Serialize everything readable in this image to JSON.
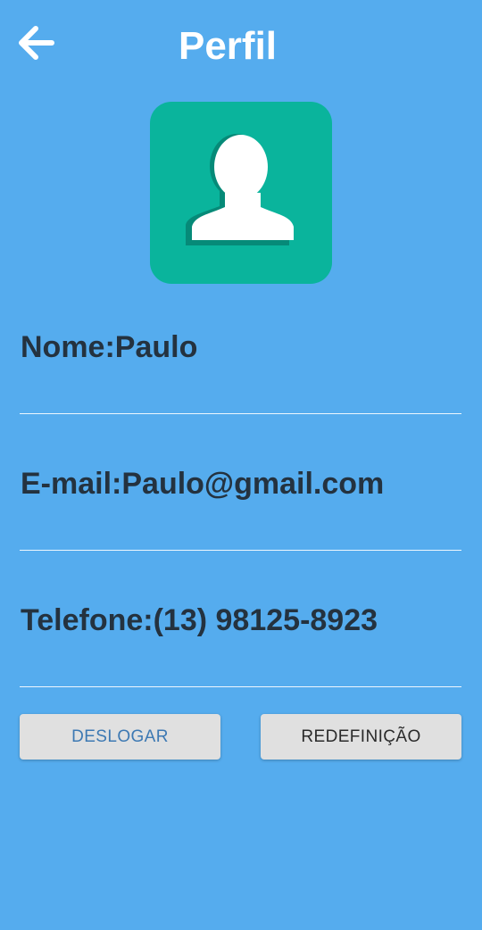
{
  "header": {
    "title": "Perfil",
    "back_icon": "arrow-left-icon"
  },
  "avatar": {
    "icon": "user-silhouette-icon",
    "background_color": "#0ab49c"
  },
  "profile": {
    "name_label": "Nome:",
    "name_value": "Paulo",
    "email_label": "E-mail:",
    "email_value": "Paulo@gmail.com",
    "phone_label": "Telefone:",
    "phone_value": "(13) 98125-8923"
  },
  "actions": {
    "logout_label": "DESLOGAR",
    "reset_label": "REDEFINIÇÃO"
  },
  "colors": {
    "background": "#55acee",
    "text": "#24323f",
    "button": "#e0e0e0",
    "logout_text": "#3d79b3"
  }
}
